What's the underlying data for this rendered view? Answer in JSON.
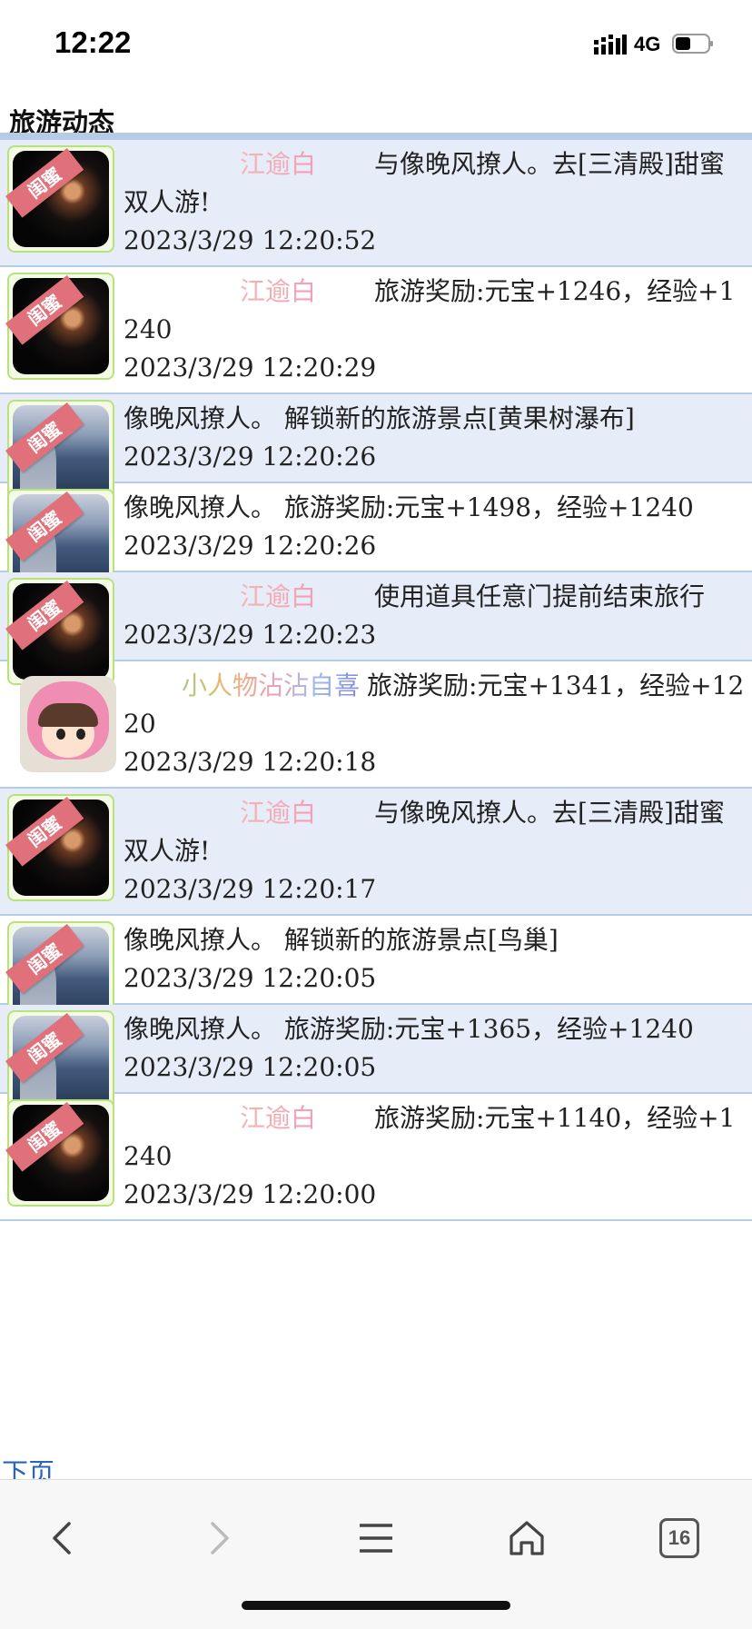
{
  "status_bar": {
    "time": "12:22",
    "network": "4G"
  },
  "page": {
    "title": "旅游动态",
    "next_page_label": "下页"
  },
  "badge_text": "闺蜜",
  "feed": [
    {
      "name": "江逾白",
      "name_style": "pink",
      "text": "与像晚风撩人。去[三清殿]甜蜜双人游!",
      "time": "2023/3/29 12:20:52",
      "avatar": "night",
      "shaded": true
    },
    {
      "name": "江逾白",
      "name_style": "pink",
      "text": "旅游奖励:元宝+1246，经验+1240",
      "time": "2023/3/29 12:20:29",
      "avatar": "night",
      "shaded": false
    },
    {
      "name": "",
      "text": "像晚风撩人。 解锁新的旅游景点[黄果树瀑布]",
      "time": "2023/3/29 12:20:26",
      "avatar": "sea",
      "shaded": true
    },
    {
      "name": "",
      "text": "像晚风撩人。 旅游奖励:元宝+1498，经验+1240",
      "time": "2023/3/29 12:20:26",
      "avatar": "sea",
      "shaded": false
    },
    {
      "name": "江逾白",
      "name_style": "pink",
      "text": "使用道具任意门提前结束旅行",
      "time": "2023/3/29 12:20:23",
      "avatar": "night",
      "shaded": true
    },
    {
      "name": "小人物沾沾自喜",
      "name_style": "rainbow",
      "text": "旅游奖励:元宝+1341，经验+1220",
      "time": "2023/3/29 12:20:18",
      "avatar": "cartoon",
      "shaded": false
    },
    {
      "name": "江逾白",
      "name_style": "pink",
      "text": "与像晚风撩人。去[三清殿]甜蜜双人游!",
      "time": "2023/3/29 12:20:17",
      "avatar": "night",
      "shaded": true
    },
    {
      "name": "",
      "text": "像晚风撩人。 解锁新的旅游景点[鸟巢]",
      "time": "2023/3/29 12:20:05",
      "avatar": "sea",
      "shaded": false
    },
    {
      "name": "",
      "text": "像晚风撩人。 旅游奖励:元宝+1365，经验+1240",
      "time": "2023/3/29 12:20:05",
      "avatar": "sea",
      "shaded": true
    },
    {
      "name": "江逾白",
      "name_style": "pink",
      "text": "旅游奖励:元宝+1140，经验+1240",
      "time": "2023/3/29 12:20:00",
      "avatar": "night",
      "shaded": false
    }
  ],
  "toolbar": {
    "tab_count": "16",
    "icons": [
      "back-icon",
      "forward-icon",
      "menu-icon",
      "home-icon",
      "tabs-icon"
    ]
  }
}
